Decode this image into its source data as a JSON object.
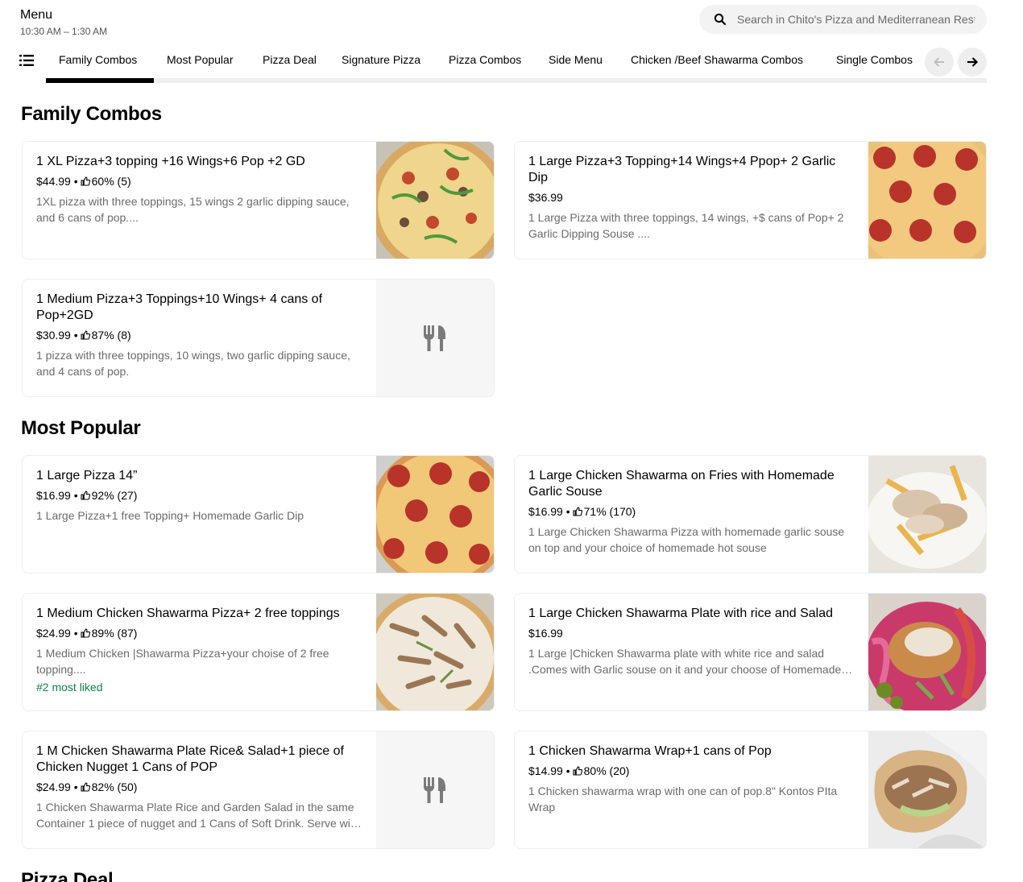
{
  "header": {
    "title": "Menu",
    "hours": "10:30 AM – 1:30 AM",
    "search_placeholder": "Search in Chito's Pizza and Mediterranean Restaurant"
  },
  "tabs": [
    {
      "label": "Family Combos",
      "active": true
    },
    {
      "label": "Most Popular"
    },
    {
      "label": "Pizza Deal"
    },
    {
      "label": "Signature Pizza"
    },
    {
      "label": "Pizza Combos"
    },
    {
      "label": "Side Menu"
    },
    {
      "label": "Chicken /Beef Shawarma Combos"
    },
    {
      "label": "Single Combos"
    }
  ],
  "icons": {
    "search": "search-icon",
    "list": "list-icon",
    "prev": "arrow-left-icon",
    "next": "arrow-right-icon",
    "like": "thumbs-up-icon",
    "placeholder": "fork-knife-icon"
  },
  "colors": {
    "accent": "#000000",
    "badge_green": "#0e8345",
    "muted_text": "#6b6b6b"
  },
  "sections": [
    {
      "title": "Family Combos",
      "items": [
        {
          "name": "1 XL Pizza+3 topping +16 Wings+6 Pop +2 GD",
          "price": "$44.99",
          "rating": "60% (5)",
          "description": "1XL pizza with three toppings, 15 wings 2 garlic dipping sauce, and 6 cans of pop....",
          "image": "veggie-pizza"
        },
        {
          "name": "1 Large Pizza+3 Topping+14 Wings+4 Ppop+ 2 Garlic Dip",
          "price": "$36.99",
          "rating": "",
          "description": "1 Large Pizza with three toppings, 14 wings, +$ cans of Pop+ 2 Garlic Dipping Souse ....",
          "image": "pepperoni-pizza"
        },
        {
          "name": "1 Medium Pizza+3 Toppings+10 Wings+ 4 cans of Pop+2GD",
          "price": "$30.99",
          "rating": "87% (8)",
          "description": "1 pizza with three toppings, 10 wings, two garlic dipping sauce, and 4 cans of pop.",
          "image": "placeholder"
        }
      ]
    },
    {
      "title": "Most Popular",
      "items": [
        {
          "name": "1 Large Pizza 14”",
          "price": "$16.99",
          "rating": "92% (27)",
          "description": "1 Large Pizza+1 free Topping+ Homemade Garlic Dip",
          "image": "pepperoni-pizza"
        },
        {
          "name": "1 Large Chicken Shawarma on Fries with Homemade Garlic Souse",
          "price": "$16.99",
          "rating": "71% (170)",
          "description": "1 Large Chicken Shawarma Pizza with homemade garlic souse on top and your choice of homemade hot souse",
          "image": "shawarma-fries"
        },
        {
          "name": "1 Medium Chicken Shawarma Pizza+ 2 free toppings",
          "price": "$24.99",
          "rating": "89% (87)",
          "description": "1 Medium Chicken |Shawarma Pizza+your choise of 2 free topping....",
          "badge": "#2 most liked",
          "image": "shawarma-pizza"
        },
        {
          "name": "1 Large  Chicken Shawarma Plate with rice and Salad",
          "price": "$16.99",
          "rating": "",
          "description": "1 Large |Chicken Shawarma plate with white rice and salad .Comes with Garlic souse on it and your choose of Homemade hot souse",
          "image": "shawarma-plate"
        },
        {
          "name": "1  M Chicken Shawarma Plate Rice& Salad+1 piece of Chicken Nugget 1 Cans of POP",
          "price": "$24.99",
          "rating": "82% (50)",
          "description": "1 Chicken Shawarma Plate Rice and Garden Salad in the same Container 1 piece of nugget and 1 Cans of Soft Drink. Serve with garlic souse",
          "image": "placeholder"
        },
        {
          "name": "1 Chicken Shawarma Wrap+1 cans of Pop",
          "price": "$14.99",
          "rating": "80% (20)",
          "description": "1 Chicken shawarma wrap with one can of pop.8\" Kontos PIta Wrap",
          "image": "shawarma-wrap"
        }
      ]
    },
    {
      "title": "Pizza Deal",
      "items": []
    }
  ]
}
